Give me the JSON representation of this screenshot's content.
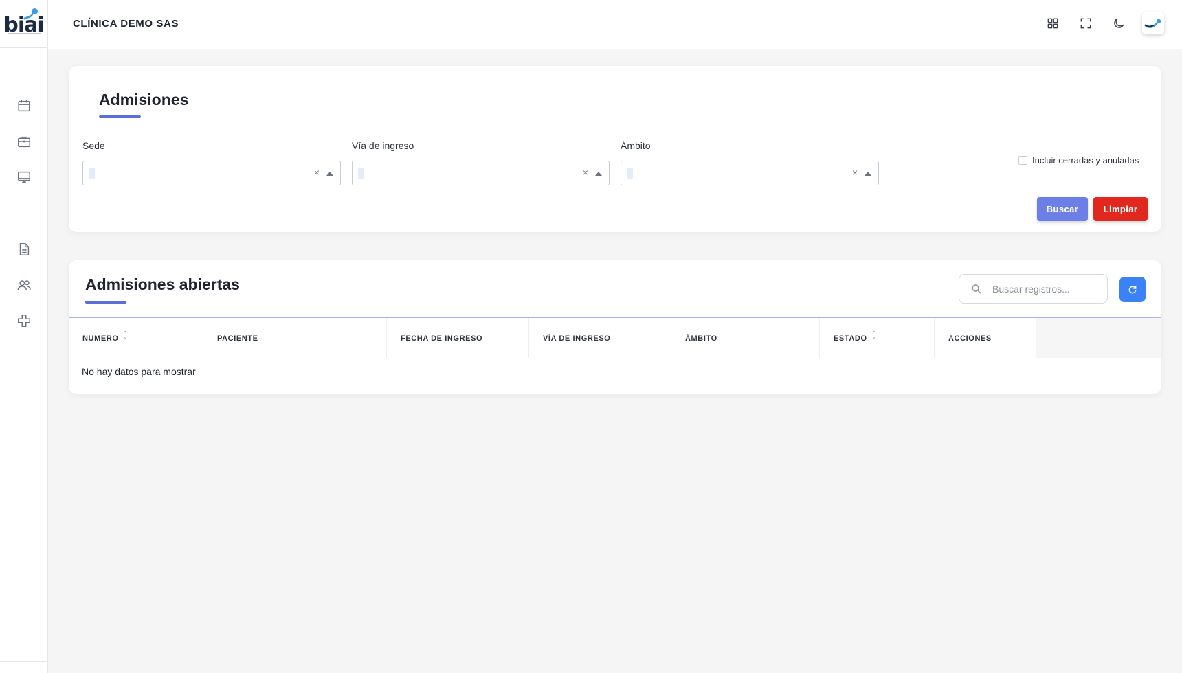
{
  "app": {
    "logo_text": "biai",
    "company_name": "CLÍNICA DEMO SAS"
  },
  "sidebar": {
    "items": [
      {
        "icon": "calendar-icon"
      },
      {
        "icon": "briefcase-icon"
      },
      {
        "icon": "monitor-icon"
      },
      {
        "icon": "document-icon"
      },
      {
        "icon": "users-icon"
      },
      {
        "icon": "medical-cross-icon"
      }
    ]
  },
  "topbar": {
    "icons": [
      "apps-grid-icon",
      "fullscreen-icon",
      "dark-mode-icon"
    ],
    "avatar_icon": "user-avatar-logo"
  },
  "filters": {
    "title": "Admisiones",
    "sede_label": "Sede",
    "via_label": "Vía de ingreso",
    "ambito_label": "Ámbito",
    "clear_symbol": "×",
    "include_closed_label": "Incluir cerradas y anuladas",
    "include_closed_checked": false,
    "search_button": "Buscar",
    "clear_button": "Limpiar"
  },
  "table": {
    "title": "Admisiones abiertas",
    "search_placeholder": "Buscar registros...",
    "columns": {
      "numero": "NÚMERO",
      "paciente": "PACIENTE",
      "fecha": "FECHA DE INGRESO",
      "via": "VÍA DE INGRESO",
      "ambito": "ÁMBITO",
      "estado": "ESTADO",
      "acciones": "ACCIONES"
    },
    "sort_up": "⌃",
    "sort_down": "⌄",
    "empty_text": "No hay datos para mostrar"
  },
  "colors": {
    "accent": "#5b6fd8",
    "primary_button": "#6b7fe6",
    "danger_button": "#e1281f",
    "refresh_button": "#3b82f6",
    "logo_blue": "#3b9de8"
  }
}
